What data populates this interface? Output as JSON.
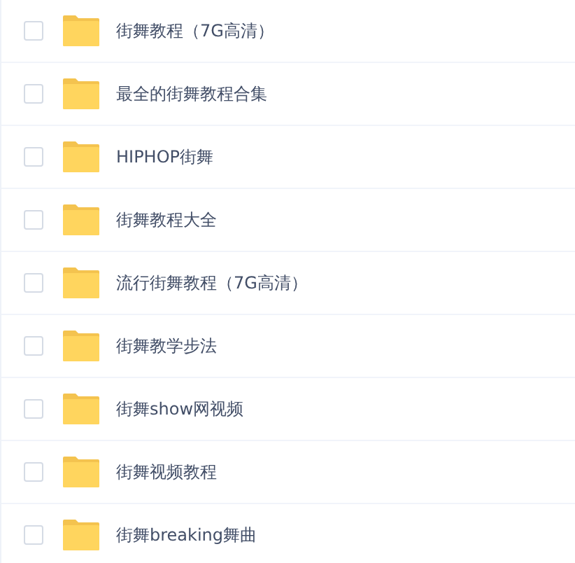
{
  "files": [
    {
      "name": "街舞教程（7G高清）",
      "checked": false
    },
    {
      "name": "最全的街舞教程合集",
      "checked": false
    },
    {
      "name": "HIPHOP街舞",
      "checked": false
    },
    {
      "name": "街舞教程大全",
      "checked": false
    },
    {
      "name": "流行街舞教程（7G高清）",
      "checked": false
    },
    {
      "name": "街舞教学步法",
      "checked": false
    },
    {
      "name": "街舞show网视频",
      "checked": false
    },
    {
      "name": "街舞视频教程",
      "checked": false
    },
    {
      "name": "街舞breaking舞曲",
      "checked": false
    }
  ]
}
